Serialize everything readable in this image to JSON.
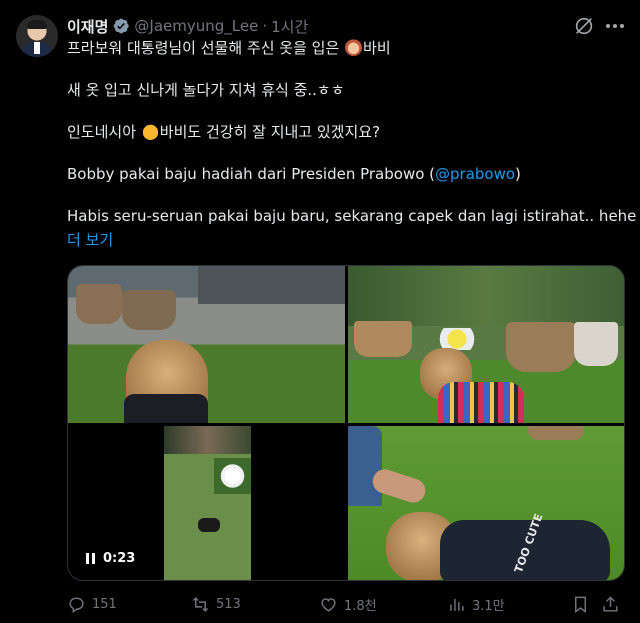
{
  "author": {
    "name": "이재명",
    "handle": "@Jaemyung_Lee",
    "time": "1시간"
  },
  "body": {
    "line1_prefix": "프라보워 대통령님이 선물해 주신 옷을 입은",
    "line1_suffix": "바비",
    "line2": "새 옷 입고 신나게 놀다가 지쳐 휴식 중..ㅎㅎ",
    "line3_prefix": "인도네시아",
    "line3_suffix": "바비도 건강히 잘 지내고 있겠지요?",
    "line4_prefix": "Bobby pakai baju hadiah dari Presiden Prabowo (",
    "line4_mention": "@prabowo",
    "line4_suffix": ")",
    "line5": "Habis seru-seruan pakai baju baru, sekarang capek dan lagi istirahat.. hehe",
    "show_more": "더 보기"
  },
  "media": {
    "video_duration": "0:23",
    "shirt_text": "TOO CUTE"
  },
  "actions": {
    "replies": "151",
    "reposts": "513",
    "likes": "1.8천",
    "views": "3.1만"
  },
  "colors": {
    "accent": "#1d9bf0",
    "muted": "#71767b",
    "text": "#e7e9ea",
    "background": "#000000"
  },
  "icons": [
    "verified-badge-icon",
    "grok-icon",
    "more-icon",
    "reply-icon",
    "repost-icon",
    "like-icon",
    "views-icon",
    "bookmark-icon",
    "share-icon",
    "pause-icon"
  ]
}
